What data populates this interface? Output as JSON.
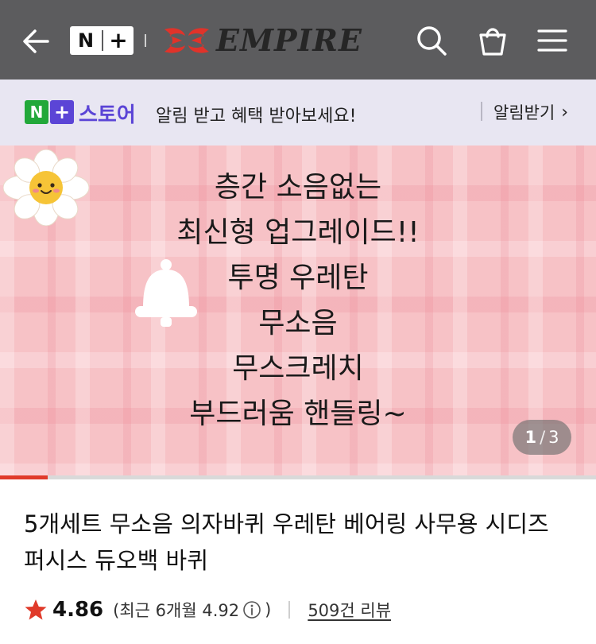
{
  "header": {
    "back_icon": "arrow-left-icon",
    "logo_n": "N",
    "logo_plus": "+",
    "brand_name": "EMPIRE",
    "search_icon": "search-icon",
    "cart_icon": "shopping-bag-icon",
    "menu_icon": "hamburger-menu-icon",
    "bg_color": "#5c5c5e"
  },
  "store_bar": {
    "logo_n": "N",
    "logo_plus": "+",
    "store_label": "스토어",
    "message": "알림 받고 혜택 받아보세요!",
    "alarm_label": "알림받기",
    "chevron": "›",
    "accent_color": "#5b45d6",
    "green_color": "#22a83a"
  },
  "banner": {
    "lines": [
      "층간 소음없는",
      "최신형 업그레이드!!",
      "투명 우레탄",
      "무소음",
      "무스크레치",
      "부드러움 핸들링~"
    ],
    "current_page": "1",
    "separator": "/",
    "total_pages": "3",
    "progress_fraction": 0.333,
    "progress_color": "#e03a2a",
    "decor_icons": [
      "flower-icon",
      "bell-icon"
    ]
  },
  "product": {
    "title": "5개세트 무소음 의자바퀴 우레탄 베어링 사무용 시디즈 퍼시스 듀오백 바퀴",
    "rating": "4.86",
    "recent_rating_text": "(최근 6개월 4.92",
    "recent_rating_close": ")",
    "review_count": "509건 리뷰",
    "star_color": "#e03a2a"
  }
}
